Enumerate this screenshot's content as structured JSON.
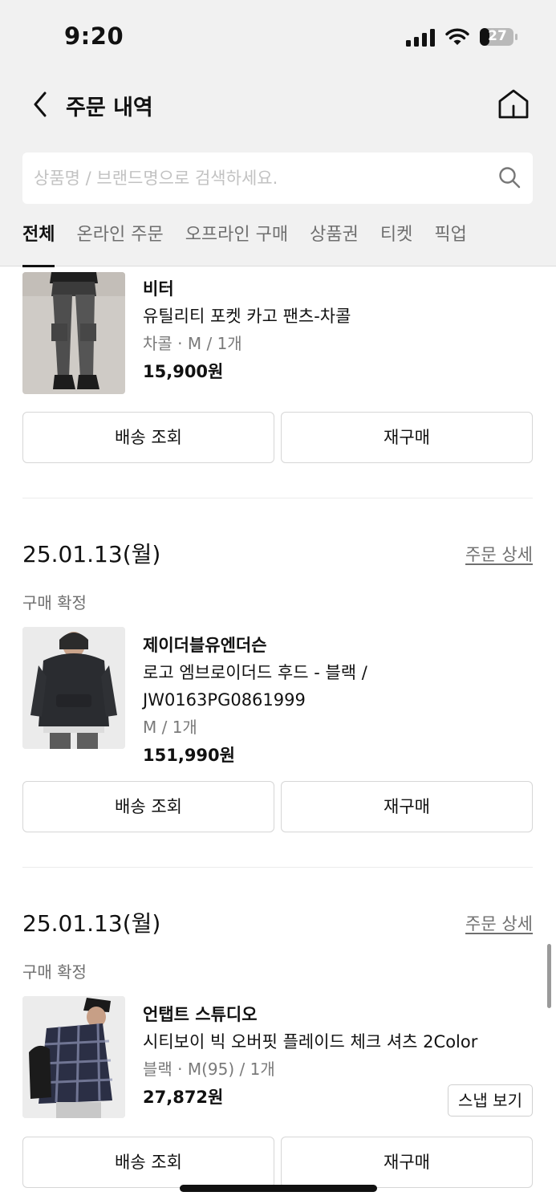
{
  "status_bar": {
    "time": "9:20",
    "battery": "27"
  },
  "nav": {
    "title": "주문 내역"
  },
  "search": {
    "placeholder": "상품명 / 브랜드명으로 검색하세요."
  },
  "tabs": [
    {
      "label": "전체",
      "active": true
    },
    {
      "label": "온라인 주문"
    },
    {
      "label": "오프라인 구매"
    },
    {
      "label": "상품권"
    },
    {
      "label": "티켓"
    },
    {
      "label": "픽업"
    }
  ],
  "orders": [
    {
      "product": {
        "brand": "비터",
        "name": "유틸리티 포켓 카고 팬츠-차콜",
        "option": "차콜 · M / 1개",
        "price": "15,900원"
      },
      "buttons": {
        "left": "배송 조회",
        "right": "재구매"
      }
    },
    {
      "date": "25.01.13(월)",
      "detail_link": "주문 상세",
      "status": "구매 확정",
      "product": {
        "brand": "제이더블유엔더슨",
        "name_line1": "로고 엠브로이더드 후드 - 블랙 /",
        "name_line2": "JW0163PG0861999",
        "option": "M / 1개",
        "price": "151,990원"
      },
      "buttons": {
        "left": "배송 조회",
        "right": "재구매"
      }
    },
    {
      "date": "25.01.13(월)",
      "detail_link": "주문 상세",
      "status": "구매 확정",
      "product": {
        "brand": "언탭트 스튜디오",
        "name": "시티보이 빅 오버핏 플레이드 체크 셔츠 2Color",
        "option": "블랙 · M(95) / 1개",
        "price": "27,872원",
        "snap_label": "스냅 보기"
      },
      "buttons": {
        "left": "배송 조회",
        "right": "재구매"
      }
    }
  ],
  "colors": {
    "header_bg": "#f1f1f1",
    "muted_text": "#6f6f6f",
    "border": "#d6d6d6"
  },
  "icons": [
    "back-chevron-icon",
    "home-icon",
    "search-icon",
    "signal-icon",
    "wifi-icon",
    "battery-icon"
  ]
}
